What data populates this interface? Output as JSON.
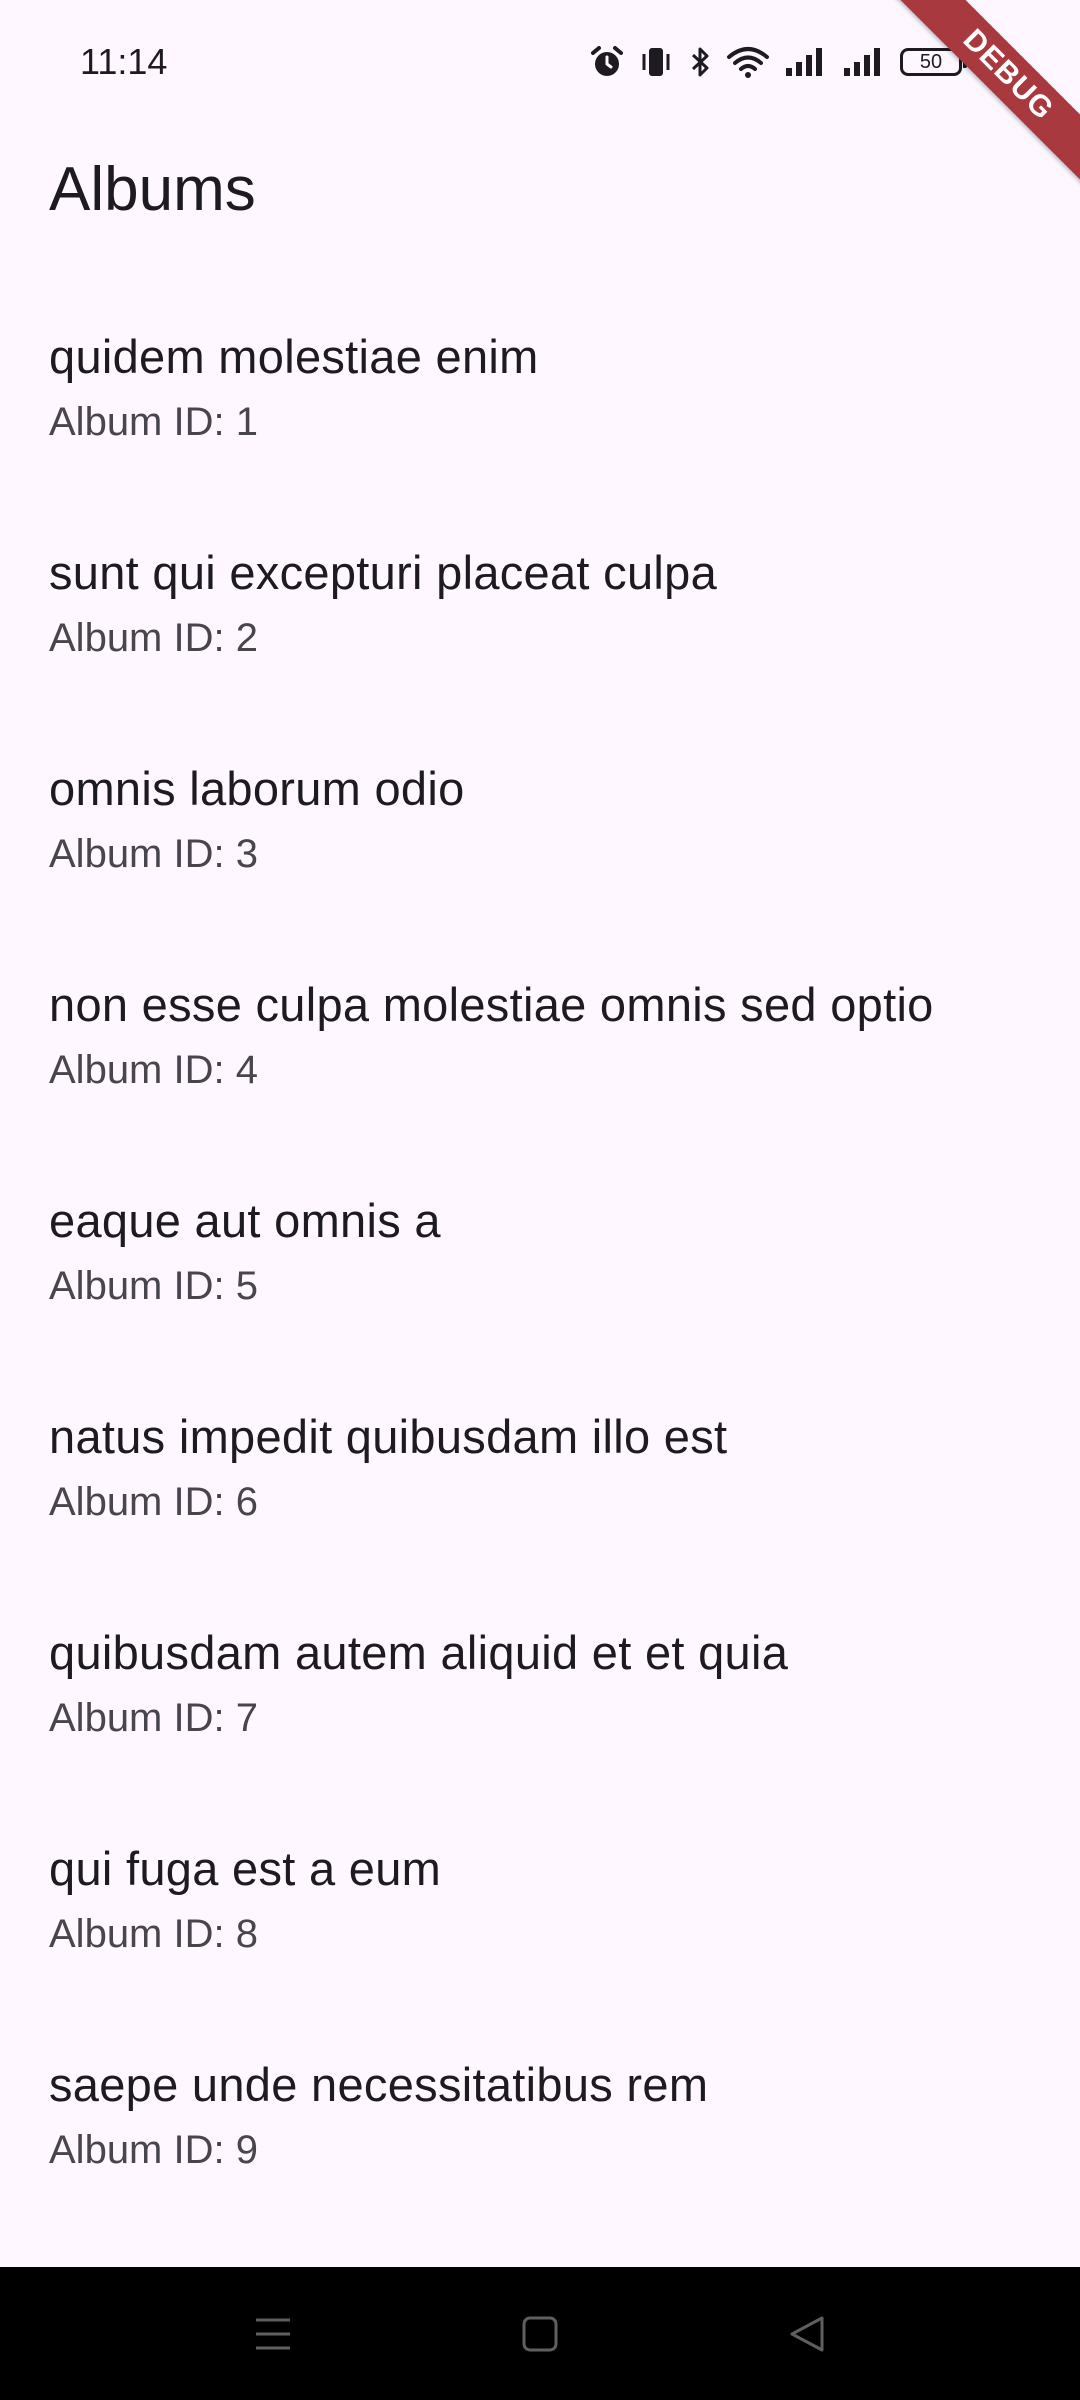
{
  "status_bar": {
    "time": "11:14",
    "battery_level": "50",
    "icons": [
      "alarm-icon",
      "vibrate-icon",
      "bluetooth-icon",
      "wifi-icon",
      "signal-icon",
      "signal-icon",
      "battery-icon",
      "charging-icon"
    ]
  },
  "debug_banner": "DEBUG",
  "app_bar": {
    "title": "Albums"
  },
  "albums": [
    {
      "title": "quidem molestiae enim",
      "subtitle": "Album ID: 1"
    },
    {
      "title": "sunt qui excepturi placeat culpa",
      "subtitle": "Album ID: 2"
    },
    {
      "title": "omnis laborum odio",
      "subtitle": "Album ID: 3"
    },
    {
      "title": "non esse culpa molestiae omnis sed optio",
      "subtitle": "Album ID: 4"
    },
    {
      "title": "eaque aut omnis a",
      "subtitle": "Album ID: 5"
    },
    {
      "title": "natus impedit quibusdam illo est",
      "subtitle": "Album ID: 6"
    },
    {
      "title": "quibusdam autem aliquid et et quia",
      "subtitle": "Album ID: 7"
    },
    {
      "title": "qui fuga est a eum",
      "subtitle": "Album ID: 8"
    },
    {
      "title": "saepe unde necessitatibus rem",
      "subtitle": "Album ID: 9"
    }
  ],
  "nav_bar": {
    "buttons": [
      "menu-icon",
      "home-icon",
      "back-icon"
    ]
  },
  "colors": {
    "background": "#FEF7FF",
    "text_primary": "#1D1B20",
    "text_secondary": "#49454F",
    "debug_banner": "#A8393F",
    "nav_bar": "#000000"
  }
}
